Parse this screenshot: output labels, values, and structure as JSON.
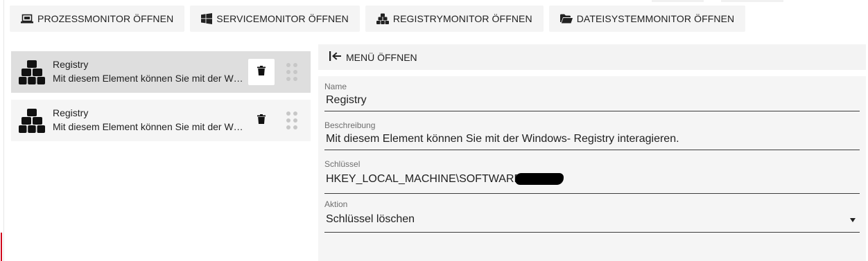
{
  "toolbar": {
    "buttons": [
      {
        "label": "PROZESSMONITOR ÖFFNEN",
        "icon": "laptop-icon"
      },
      {
        "label": "SERVICEMONITOR ÖFFNEN",
        "icon": "windows-icon"
      },
      {
        "label": "REGISTRYMONITOR ÖFFNEN",
        "icon": "cubes-icon"
      },
      {
        "label": "DATEISYSTEMMONITOR ÖFFNEN",
        "icon": "folder-icon"
      }
    ]
  },
  "list": {
    "items": [
      {
        "title": "Registry",
        "description": "Mit diesem Element können Sie mit der Windows- Registry interagieren.",
        "icon": "cubes-icon",
        "selected": true
      },
      {
        "title": "Registry",
        "description": "Mit diesem Element können Sie mit der Windows- Registry interagieren.",
        "icon": "cubes-icon",
        "selected": false
      }
    ]
  },
  "panel": {
    "menu_label": "MENÜ ÖFFNEN",
    "fields": {
      "name": {
        "label": "Name",
        "value": "Registry"
      },
      "description": {
        "label": "Beschreibung",
        "value": "Mit diesem Element können Sie mit der Windows- Registry interagieren."
      },
      "key": {
        "label": "Schlüssel",
        "value": "HKEY_LOCAL_MACHINE\\SOFTWARE"
      },
      "action": {
        "label": "Aktion",
        "value": "Schlüssel löschen"
      }
    }
  },
  "colors": {
    "accent_mark": "#d0021b",
    "selected_item": "#dedede",
    "item_background": "#f5f5f5"
  }
}
